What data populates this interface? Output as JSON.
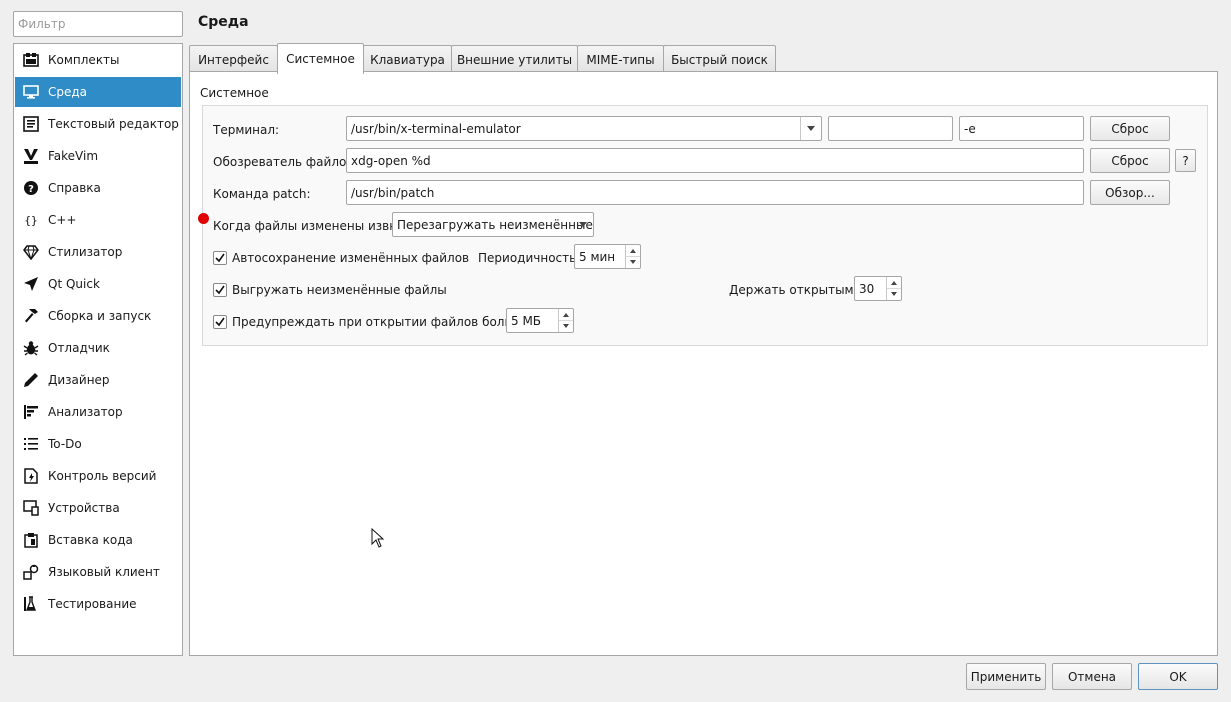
{
  "filter": {
    "placeholder": "Фильтр"
  },
  "sidebar": {
    "items": [
      {
        "label": "Комплекты",
        "icon": "kits-icon"
      },
      {
        "label": "Среда",
        "icon": "monitor-icon"
      },
      {
        "label": "Текстовый редактор",
        "icon": "text-editor-icon"
      },
      {
        "label": "FakeVim",
        "icon": "fakevim-icon"
      },
      {
        "label": "Справка",
        "icon": "help-icon"
      },
      {
        "label": "C++",
        "icon": "braces-icon"
      },
      {
        "label": "Стилизатор",
        "icon": "beautifier-icon"
      },
      {
        "label": "Qt Quick",
        "icon": "qt-quick-icon"
      },
      {
        "label": "Сборка и запуск",
        "icon": "hammer-icon"
      },
      {
        "label": "Отладчик",
        "icon": "bug-icon"
      },
      {
        "label": "Дизайнер",
        "icon": "pencil-icon"
      },
      {
        "label": "Анализатор",
        "icon": "analyzer-icon"
      },
      {
        "label": "To-Do",
        "icon": "todo-list-icon"
      },
      {
        "label": "Контроль версий",
        "icon": "version-control-icon"
      },
      {
        "label": "Устройства",
        "icon": "devices-icon"
      },
      {
        "label": "Вставка кода",
        "icon": "code-paste-icon"
      },
      {
        "label": "Языковый клиент",
        "icon": "language-client-icon"
      },
      {
        "label": "Тестирование",
        "icon": "testing-icon"
      }
    ]
  },
  "page_title": "Среда",
  "tabs": [
    {
      "label": "Интерфейс"
    },
    {
      "label": "Системное"
    },
    {
      "label": "Клавиатура"
    },
    {
      "label": "Внешние утилиты"
    },
    {
      "label": "MIME-типы"
    },
    {
      "label": "Быстрый поиск"
    }
  ],
  "system": {
    "group_title": "Системное",
    "terminal_label": "Терминал:",
    "terminal_value": "/usr/bin/x-terminal-emulator",
    "terminal_extra_value": "",
    "terminal_args": "-e",
    "terminal_reset": "Сброс",
    "file_browser_label": "Обозреватель файлов:",
    "file_browser_value": "xdg-open %d",
    "file_browser_reset": "Сброс",
    "file_browser_help": "?",
    "patch_label": "Команда patch:",
    "patch_value": "/usr/bin/patch",
    "patch_browse": "Обзор...",
    "reload_label": "Когда файлы изменены извне:",
    "reload_value": "Перезагружать неизменённые",
    "autosave_label": "Автосохранение изменённых файлов",
    "autosave_checked": true,
    "interval_label": "Периодичность:",
    "interval_value": "5 мин",
    "unload_label": "Выгружать неизменённые файлы",
    "unload_checked": true,
    "keep_open_label": "Держать открытыми:",
    "keep_open_value": "30",
    "warn_label": "Предупреждать при открытии файлов больше",
    "warn_checked": true,
    "warn_value": "5 МБ"
  },
  "buttons": {
    "apply": "Применить",
    "cancel": "Отмена",
    "ok": "OK"
  },
  "colors": {
    "selection": "#308cc6",
    "indicator": "#e00000"
  }
}
